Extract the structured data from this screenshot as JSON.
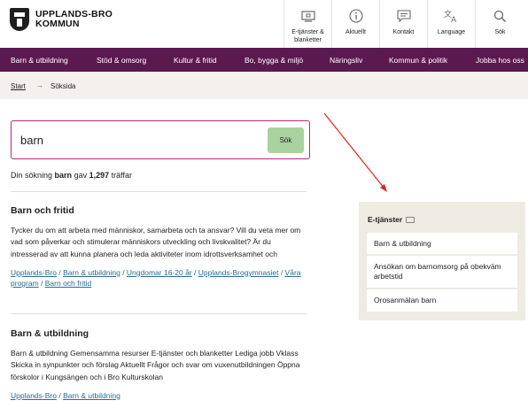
{
  "header": {
    "logo_line1": "UPPLANDS-BRO",
    "logo_line2": "KOMMUN",
    "tools": [
      {
        "label": "E-tjänster & blanketter",
        "icon": "computer-icon"
      },
      {
        "label": "Aktuellt",
        "icon": "info-icon"
      },
      {
        "label": "Kontakt",
        "icon": "chat-icon"
      },
      {
        "label": "Language",
        "icon": "translate-icon"
      },
      {
        "label": "Sök",
        "icon": "search-icon"
      }
    ]
  },
  "nav": {
    "items": [
      "Barn & utbildning",
      "Stöd & omsorg",
      "Kultur & fritid",
      "Bo, bygga & miljö",
      "Näringsliv",
      "Kommun & politik",
      "Jobba hos oss"
    ]
  },
  "breadcrumb": {
    "start": "Start",
    "separator": "→",
    "current": "Söksida"
  },
  "search": {
    "value": "barn",
    "button_label": "Sök",
    "summary_prefix": "Din sökning",
    "summary_term": "barn",
    "summary_mid": "gav",
    "summary_count": "1,297",
    "summary_suffix": "träffar"
  },
  "results": [
    {
      "title": "Barn och fritid",
      "text": "Tycker du om att arbeta med människor, samarbeta och ta ansvar? Vill du veta mer om vad som påverkar och stimulerar människors utveckling och livskvalitet? Är du intresserad av att kunna planera och leda aktiviteter inom idrottsverksamhet och",
      "links": [
        "Upplands-Bro",
        "Barn & utbildning",
        "Ungdomar 16-20 år",
        "Upplands-Brogymnasiet",
        "Våra program",
        "Barn och fritid"
      ]
    },
    {
      "title": "Barn & utbildning",
      "text": "Barn & utbildning Gemensamma resurser E-tjänster och blanketter Lediga jobb Vklass Skicka in synpunkter och förslag Aktuellt Frågor och svar om vuxenutbildningen Öppna förskolor i Kungsängen och i Bro Kulturskolan",
      "links": [
        "Upplands-Bro",
        "Barn & utbildning"
      ]
    }
  ],
  "etjanster": {
    "title": "E-tjänster",
    "items": [
      "Barn & utbildning",
      "Ansökan om barnomsorg på obekväm arbetstid",
      "Orosanmälan barn"
    ]
  },
  "colors": {
    "nav_bg": "#5b1a4f",
    "search_border": "#b22a7a",
    "search_button": "#a8d39f",
    "link": "#2b6b8e",
    "annotation": "#e0261c"
  }
}
